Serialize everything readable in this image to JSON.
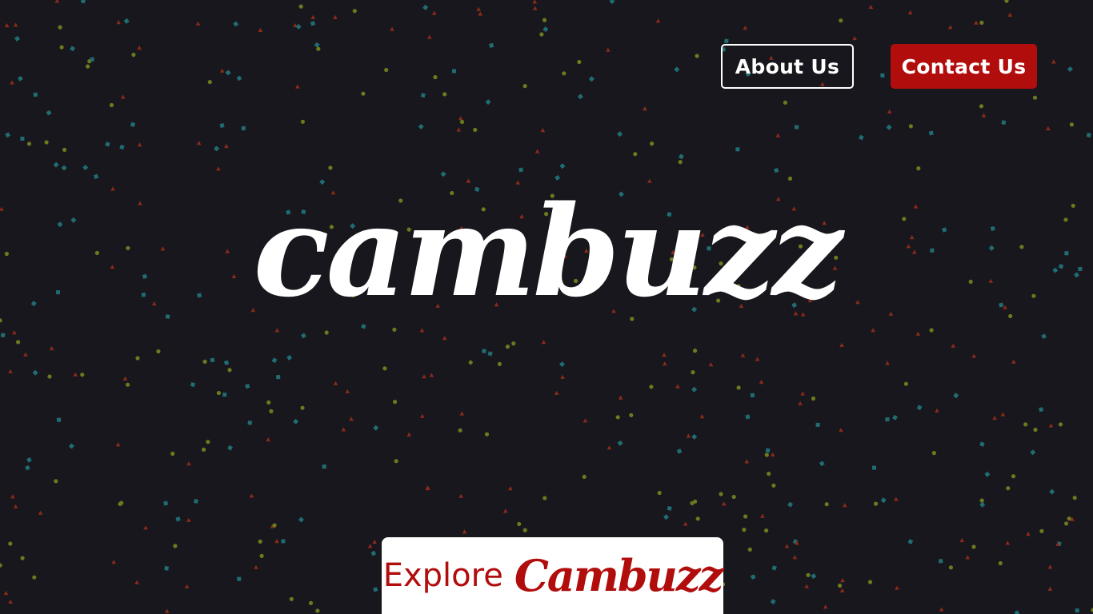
{
  "nav": {
    "about_label": "About Us",
    "contact_label": "Contact Us"
  },
  "hero": {
    "logo_text": "cambuzz"
  },
  "cta": {
    "prefix": "Explore",
    "brand": "Cambuzz"
  },
  "colors": {
    "background": "#18171d",
    "brand_red": "#b20d0d",
    "white": "#ffffff",
    "confetti": [
      "#6b7a1f",
      "#1f6d73",
      "#8a2a1a"
    ]
  },
  "icons": {
    "background_pattern": "confetti-particles"
  }
}
